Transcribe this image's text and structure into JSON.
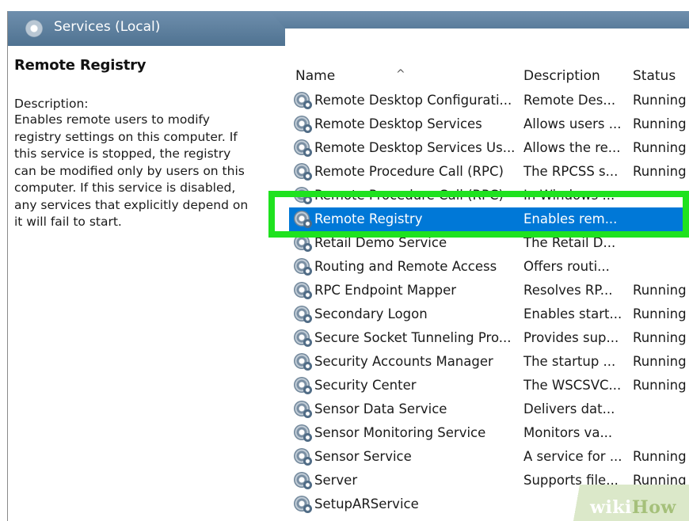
{
  "header": {
    "title": "Services (Local)"
  },
  "details": {
    "service_title": "Remote Registry",
    "description_label": "Description:",
    "description_lines": "Enables remote users to modify\nregistry settings on this computer. If\nthis service is stopped, the registry\ncan be modified only by users on this\ncomputer. If this service is disabled,\nany services that explicitly depend on\nit will fail to start."
  },
  "columns": {
    "name": "Name",
    "description": "Description",
    "status": "Status",
    "sort_indicator": "^"
  },
  "services": [
    {
      "name": "Remote Desktop Configurati...",
      "description": "Remote Des...",
      "status": "Running"
    },
    {
      "name": "Remote Desktop Services",
      "description": "Allows users ...",
      "status": "Running"
    },
    {
      "name": "Remote Desktop Services Us...",
      "description": "Allows the re...",
      "status": "Running"
    },
    {
      "name": "Remote Procedure Call (RPC)",
      "description": "The RPCSS s...",
      "status": "Running"
    },
    {
      "name": "Remote Procedure Call (RPC)",
      "description": "In Windows ...",
      "status": ""
    },
    {
      "name": "Remote Registry",
      "description": "Enables rem...",
      "status": "",
      "selected": true
    },
    {
      "name": "Retail Demo Service",
      "description": "The Retail D...",
      "status": ""
    },
    {
      "name": "Routing and Remote Access",
      "description": "Offers routi...",
      "status": ""
    },
    {
      "name": "RPC Endpoint Mapper",
      "description": "Resolves RP...",
      "status": "Running"
    },
    {
      "name": "Secondary Logon",
      "description": "Enables start...",
      "status": "Running"
    },
    {
      "name": "Secure Socket Tunneling Pro...",
      "description": "Provides sup...",
      "status": "Running"
    },
    {
      "name": "Security Accounts Manager",
      "description": "The startup ...",
      "status": "Running"
    },
    {
      "name": "Security Center",
      "description": "The WSCSVC...",
      "status": "Running"
    },
    {
      "name": "Sensor Data Service",
      "description": "Delivers dat...",
      "status": ""
    },
    {
      "name": "Sensor Monitoring Service",
      "description": "Monitors va...",
      "status": ""
    },
    {
      "name": "Sensor Service",
      "description": "A service for ...",
      "status": "Running"
    },
    {
      "name": "Server",
      "description": "Supports file...",
      "status": "Running"
    },
    {
      "name": "SetupARService",
      "description": "",
      "status": ""
    }
  ],
  "watermark": {
    "wiki": "wiki",
    "how": "How"
  },
  "colors": {
    "selection": "#0078d7",
    "highlight_box": "#1fe21f",
    "header_bar": "#5a7c9b"
  },
  "icons": {
    "header": "services-icon",
    "row": "gear-icon"
  }
}
